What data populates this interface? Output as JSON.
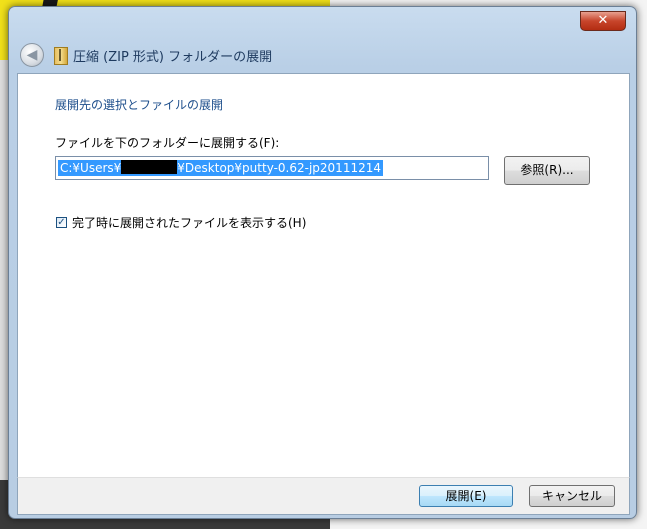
{
  "dialog": {
    "title": "圧縮 (ZIP 形式) フォルダーの展開",
    "close_symbol": "✕"
  },
  "content": {
    "section_title": "展開先の選択とファイルの展開",
    "field_label": "ファイルを下のフォルダーに展開する(F):",
    "path_prefix": "C:¥Users¥",
    "path_suffix": "¥Desktop¥putty-0.62-jp20111214",
    "browse_label": "参照(R)...",
    "show_files_checked": true,
    "checkbox_label": "完了時に展開されたファイルを表示する(H)"
  },
  "footer": {
    "extract_label": "展開(E)",
    "cancel_label": "キャンセル"
  },
  "icons": {
    "back": "back-arrow-icon",
    "zip_folder": "zip-folder-icon",
    "close": "close-icon",
    "checkmark": "checkmark-icon"
  }
}
